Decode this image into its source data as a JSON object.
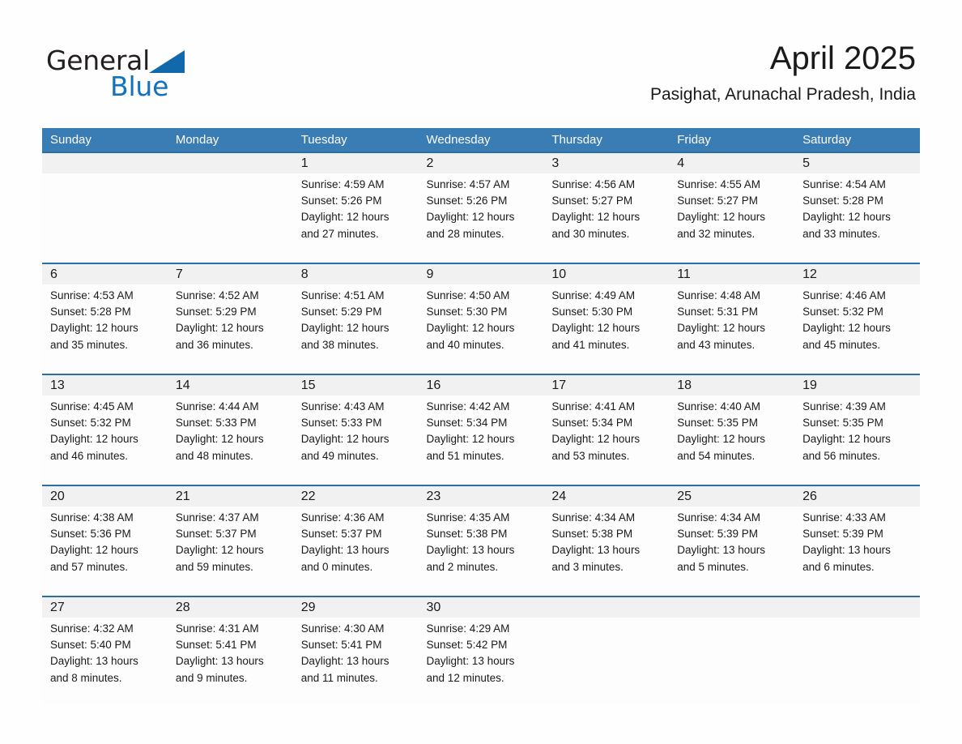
{
  "brand": {
    "name_part1": "General",
    "name_part2": "Blue",
    "triangle_icon": "blue-triangle-icon",
    "color_black": "#231f20",
    "color_blue": "#1272bc"
  },
  "header": {
    "title": "April 2025",
    "subtitle": "Pasighat, Arunachal Pradesh, India"
  },
  "theme": {
    "header_bg": "#3a7cb4",
    "week_rule": "#2a6ea6",
    "daynum_bg": "#f1f1f1",
    "page_bg": "#fefefe",
    "text": "#1a1a1a"
  },
  "calendar": {
    "day_headers": [
      "Sunday",
      "Monday",
      "Tuesday",
      "Wednesday",
      "Thursday",
      "Friday",
      "Saturday"
    ],
    "weeks": [
      [
        {
          "day": "",
          "sunrise": "",
          "sunset": "",
          "daylight1": "",
          "daylight2": ""
        },
        {
          "day": "",
          "sunrise": "",
          "sunset": "",
          "daylight1": "",
          "daylight2": ""
        },
        {
          "day": "1",
          "sunrise": "Sunrise: 4:59 AM",
          "sunset": "Sunset: 5:26 PM",
          "daylight1": "Daylight: 12 hours",
          "daylight2": "and 27 minutes."
        },
        {
          "day": "2",
          "sunrise": "Sunrise: 4:57 AM",
          "sunset": "Sunset: 5:26 PM",
          "daylight1": "Daylight: 12 hours",
          "daylight2": "and 28 minutes."
        },
        {
          "day": "3",
          "sunrise": "Sunrise: 4:56 AM",
          "sunset": "Sunset: 5:27 PM",
          "daylight1": "Daylight: 12 hours",
          "daylight2": "and 30 minutes."
        },
        {
          "day": "4",
          "sunrise": "Sunrise: 4:55 AM",
          "sunset": "Sunset: 5:27 PM",
          "daylight1": "Daylight: 12 hours",
          "daylight2": "and 32 minutes."
        },
        {
          "day": "5",
          "sunrise": "Sunrise: 4:54 AM",
          "sunset": "Sunset: 5:28 PM",
          "daylight1": "Daylight: 12 hours",
          "daylight2": "and 33 minutes."
        }
      ],
      [
        {
          "day": "6",
          "sunrise": "Sunrise: 4:53 AM",
          "sunset": "Sunset: 5:28 PM",
          "daylight1": "Daylight: 12 hours",
          "daylight2": "and 35 minutes."
        },
        {
          "day": "7",
          "sunrise": "Sunrise: 4:52 AM",
          "sunset": "Sunset: 5:29 PM",
          "daylight1": "Daylight: 12 hours",
          "daylight2": "and 36 minutes."
        },
        {
          "day": "8",
          "sunrise": "Sunrise: 4:51 AM",
          "sunset": "Sunset: 5:29 PM",
          "daylight1": "Daylight: 12 hours",
          "daylight2": "and 38 minutes."
        },
        {
          "day": "9",
          "sunrise": "Sunrise: 4:50 AM",
          "sunset": "Sunset: 5:30 PM",
          "daylight1": "Daylight: 12 hours",
          "daylight2": "and 40 minutes."
        },
        {
          "day": "10",
          "sunrise": "Sunrise: 4:49 AM",
          "sunset": "Sunset: 5:30 PM",
          "daylight1": "Daylight: 12 hours",
          "daylight2": "and 41 minutes."
        },
        {
          "day": "11",
          "sunrise": "Sunrise: 4:48 AM",
          "sunset": "Sunset: 5:31 PM",
          "daylight1": "Daylight: 12 hours",
          "daylight2": "and 43 minutes."
        },
        {
          "day": "12",
          "sunrise": "Sunrise: 4:46 AM",
          "sunset": "Sunset: 5:32 PM",
          "daylight1": "Daylight: 12 hours",
          "daylight2": "and 45 minutes."
        }
      ],
      [
        {
          "day": "13",
          "sunrise": "Sunrise: 4:45 AM",
          "sunset": "Sunset: 5:32 PM",
          "daylight1": "Daylight: 12 hours",
          "daylight2": "and 46 minutes."
        },
        {
          "day": "14",
          "sunrise": "Sunrise: 4:44 AM",
          "sunset": "Sunset: 5:33 PM",
          "daylight1": "Daylight: 12 hours",
          "daylight2": "and 48 minutes."
        },
        {
          "day": "15",
          "sunrise": "Sunrise: 4:43 AM",
          "sunset": "Sunset: 5:33 PM",
          "daylight1": "Daylight: 12 hours",
          "daylight2": "and 49 minutes."
        },
        {
          "day": "16",
          "sunrise": "Sunrise: 4:42 AM",
          "sunset": "Sunset: 5:34 PM",
          "daylight1": "Daylight: 12 hours",
          "daylight2": "and 51 minutes."
        },
        {
          "day": "17",
          "sunrise": "Sunrise: 4:41 AM",
          "sunset": "Sunset: 5:34 PM",
          "daylight1": "Daylight: 12 hours",
          "daylight2": "and 53 minutes."
        },
        {
          "day": "18",
          "sunrise": "Sunrise: 4:40 AM",
          "sunset": "Sunset: 5:35 PM",
          "daylight1": "Daylight: 12 hours",
          "daylight2": "and 54 minutes."
        },
        {
          "day": "19",
          "sunrise": "Sunrise: 4:39 AM",
          "sunset": "Sunset: 5:35 PM",
          "daylight1": "Daylight: 12 hours",
          "daylight2": "and 56 minutes."
        }
      ],
      [
        {
          "day": "20",
          "sunrise": "Sunrise: 4:38 AM",
          "sunset": "Sunset: 5:36 PM",
          "daylight1": "Daylight: 12 hours",
          "daylight2": "and 57 minutes."
        },
        {
          "day": "21",
          "sunrise": "Sunrise: 4:37 AM",
          "sunset": "Sunset: 5:37 PM",
          "daylight1": "Daylight: 12 hours",
          "daylight2": "and 59 minutes."
        },
        {
          "day": "22",
          "sunrise": "Sunrise: 4:36 AM",
          "sunset": "Sunset: 5:37 PM",
          "daylight1": "Daylight: 13 hours",
          "daylight2": "and 0 minutes."
        },
        {
          "day": "23",
          "sunrise": "Sunrise: 4:35 AM",
          "sunset": "Sunset: 5:38 PM",
          "daylight1": "Daylight: 13 hours",
          "daylight2": "and 2 minutes."
        },
        {
          "day": "24",
          "sunrise": "Sunrise: 4:34 AM",
          "sunset": "Sunset: 5:38 PM",
          "daylight1": "Daylight: 13 hours",
          "daylight2": "and 3 minutes."
        },
        {
          "day": "25",
          "sunrise": "Sunrise: 4:34 AM",
          "sunset": "Sunset: 5:39 PM",
          "daylight1": "Daylight: 13 hours",
          "daylight2": "and 5 minutes."
        },
        {
          "day": "26",
          "sunrise": "Sunrise: 4:33 AM",
          "sunset": "Sunset: 5:39 PM",
          "daylight1": "Daylight: 13 hours",
          "daylight2": "and 6 minutes."
        }
      ],
      [
        {
          "day": "27",
          "sunrise": "Sunrise: 4:32 AM",
          "sunset": "Sunset: 5:40 PM",
          "daylight1": "Daylight: 13 hours",
          "daylight2": "and 8 minutes."
        },
        {
          "day": "28",
          "sunrise": "Sunrise: 4:31 AM",
          "sunset": "Sunset: 5:41 PM",
          "daylight1": "Daylight: 13 hours",
          "daylight2": "and 9 minutes."
        },
        {
          "day": "29",
          "sunrise": "Sunrise: 4:30 AM",
          "sunset": "Sunset: 5:41 PM",
          "daylight1": "Daylight: 13 hours",
          "daylight2": "and 11 minutes."
        },
        {
          "day": "30",
          "sunrise": "Sunrise: 4:29 AM",
          "sunset": "Sunset: 5:42 PM",
          "daylight1": "Daylight: 13 hours",
          "daylight2": "and 12 minutes."
        },
        {
          "day": "",
          "sunrise": "",
          "sunset": "",
          "daylight1": "",
          "daylight2": ""
        },
        {
          "day": "",
          "sunrise": "",
          "sunset": "",
          "daylight1": "",
          "daylight2": ""
        },
        {
          "day": "",
          "sunrise": "",
          "sunset": "",
          "daylight1": "",
          "daylight2": ""
        }
      ]
    ]
  }
}
